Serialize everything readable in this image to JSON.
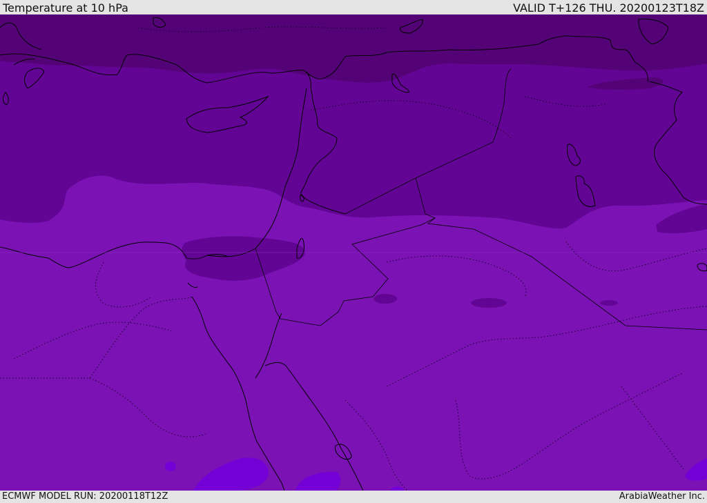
{
  "header": {
    "title": "Temperature at 10 hPa",
    "valid": "VALID T+126 THU. 20200123T18Z"
  },
  "footer": {
    "model_run": "ECMWF MODEL RUN: 20200118T12Z",
    "credit": "ArabiaWeather Inc."
  },
  "map": {
    "variable": "Temperature",
    "level": "10 hPa",
    "colors": {
      "band_darkest": "#540377",
      "band_dark": "#630594",
      "band_mid": "#7a12b4",
      "band_light": "#7400d6",
      "coast": "#000000"
    }
  }
}
